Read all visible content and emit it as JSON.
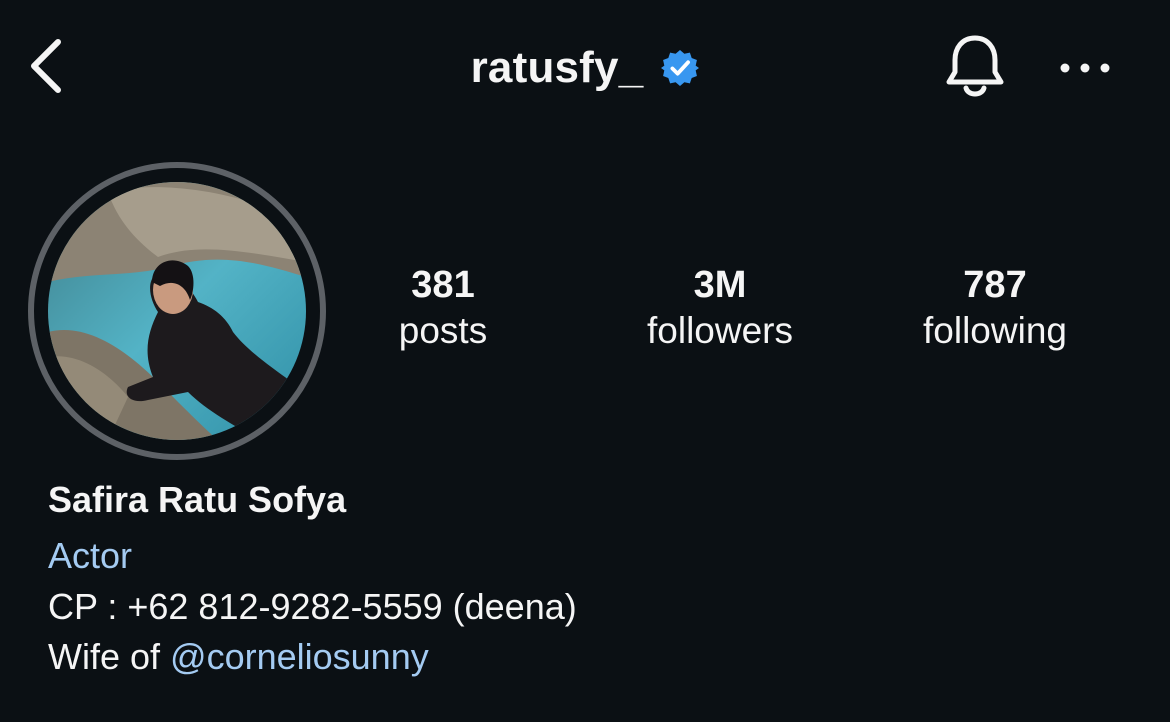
{
  "header": {
    "username": "ratusfy_",
    "verified": true,
    "icons": {
      "back": "chevron-left-icon",
      "verified": "verified-badge-icon",
      "notifications": "bell-icon",
      "more": "more-horizontal-icon"
    }
  },
  "profile": {
    "avatar_alt": "profile photo",
    "stats": {
      "posts": {
        "value": "381",
        "label": "posts"
      },
      "followers": {
        "value": "3M",
        "label": "followers"
      },
      "following": {
        "value": "787",
        "label": "following"
      }
    },
    "bio": {
      "full_name": "Safira Ratu Sofya",
      "category": "Actor",
      "line1": "CP : +62 812-9282-5559 (deena)",
      "line2_prefix": "Wife of ",
      "mention": "@corneliosunny"
    }
  },
  "colors": {
    "background": "#0b1014",
    "text": "#f5f5f5",
    "link": "#a4cbf2",
    "verified": "#3897f0",
    "ring": "#5d6166"
  }
}
